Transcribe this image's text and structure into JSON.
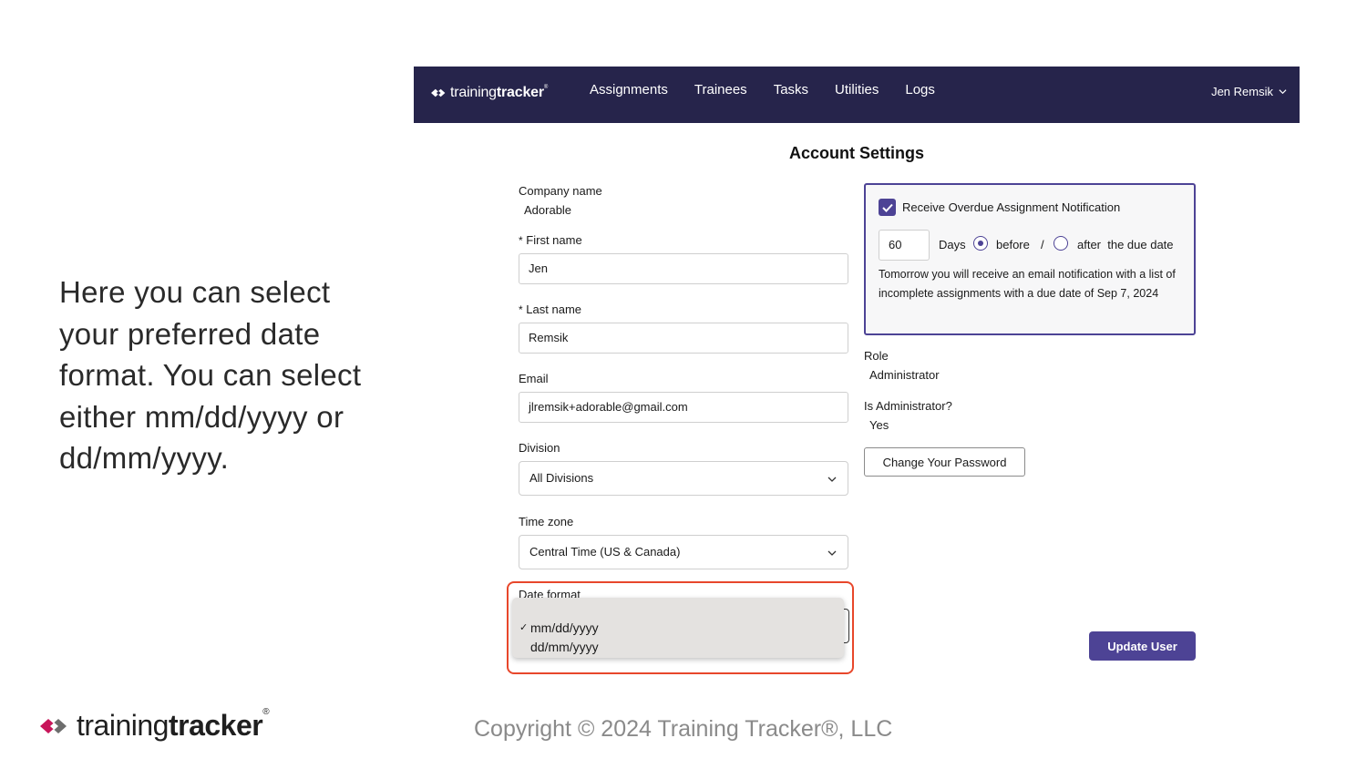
{
  "slide": {
    "intro_text": "Here you can select your preferred date format. You can select either mm/dd/yyyy or dd/mm/yyyy.",
    "brand_light": "training",
    "brand_bold": "tracker",
    "brand_mark": "®",
    "copyright": "Copyright © 2024 Training Tracker®, LLC"
  },
  "navbar": {
    "brand_light": "training",
    "brand_bold": "tracker",
    "brand_mark": "®",
    "links": [
      "Assignments",
      "Trainees",
      "Tasks",
      "Utilities",
      "Logs"
    ],
    "user": "Jen Remsik",
    "bg_color": "#26244b"
  },
  "page": {
    "title": "Account Settings"
  },
  "form": {
    "company_label": "Company name",
    "company_value": "Adorable",
    "required_marker": "*",
    "first_name_label": "First name",
    "first_name_value": "Jen",
    "last_name_label": "Last name",
    "last_name_value": "Remsik",
    "email_label": "Email",
    "email_value": "jlremsik+adorable@gmail.com",
    "division_label": "Division",
    "division_value": "All Divisions",
    "timezone_label": "Time zone",
    "timezone_value": "Central Time (US & Canada)",
    "date_format_label": "Date format",
    "date_format_options": [
      "mm/dd/yyyy",
      "dd/mm/yyyy"
    ],
    "date_format_selected": "mm/dd/yyyy",
    "check_mark": "✓"
  },
  "notification": {
    "title": "Receive Overdue Assignment Notification",
    "checked": true,
    "days_value": "60",
    "days_label": "Days",
    "before_label": "before",
    "separator": "/",
    "after_label": "after  the due date",
    "selected": "before",
    "message": "Tomorrow you will receive an email notification with a list of incomplete assignments with a due date of Sep 7, 2024"
  },
  "account": {
    "role_label": "Role",
    "role_value": "Administrator",
    "is_admin_label": "Is Administrator?",
    "is_admin_value": "Yes",
    "change_password_label": "Change Your Password",
    "update_label": "Update User"
  },
  "colors": {
    "accent": "#4d4395",
    "highlight": "#e8472b",
    "brand_pink": "#c8155a"
  }
}
